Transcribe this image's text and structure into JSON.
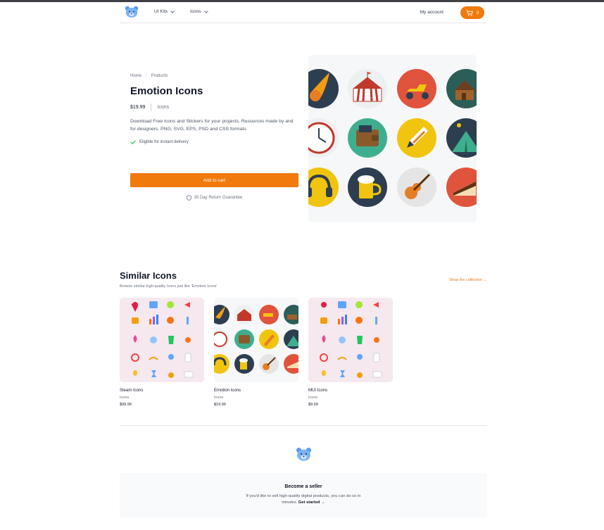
{
  "nav": {
    "ui_kits": "UI Kits",
    "icons": "Icons",
    "my_account": "My account",
    "cart_count": "0"
  },
  "breadcrumb": {
    "home": "Home",
    "sep": "/",
    "products": "Products"
  },
  "product": {
    "title": "Emotion Icons",
    "price": "$19.99",
    "category": "Icons",
    "description": "Download Free Icons and Stickers for your projects. Resources made by and for designers. PNG, SVG, EPS, PSD and CSS formats.",
    "eligibility": "Eligible for instant delivery",
    "add_to_cart": "Add to cart",
    "guarantee": "30 Day Return Guarantee"
  },
  "similar": {
    "title": "Similar Icons",
    "subtitle": "Browse similar high-quality Icons just like 'Emotion Icons'",
    "shop_link": "Shop the collection →",
    "items": [
      {
        "name": "Steam Icons",
        "category": "Icons",
        "price": "$99.99"
      },
      {
        "name": "Emotion Icons",
        "category": "Icons",
        "price": "$19.99"
      },
      {
        "name": "MUI Icons",
        "category": "Icons",
        "price": "$9.99"
      }
    ]
  },
  "footer": {
    "heading": "Become a seller",
    "text": "If you'd like to sell high-quality digital products, you can do so in minutes.",
    "link": "Get started →"
  },
  "colors": {
    "accent": "#f07a0c",
    "hero_bg": "#f6f7f8",
    "pastel_bg": "#f5e8ee"
  }
}
